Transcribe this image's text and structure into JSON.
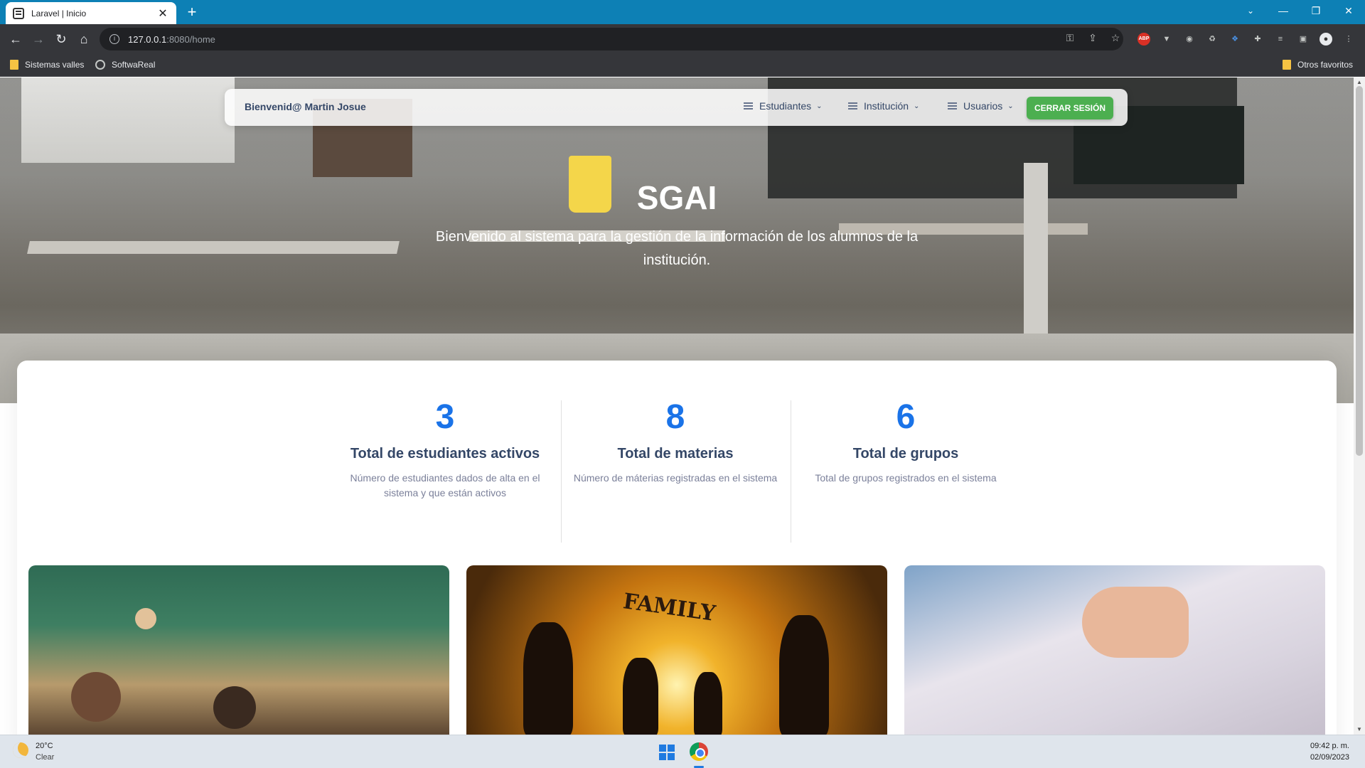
{
  "browser": {
    "tab_title": "Laravel | Inicio",
    "url_host": "127.0.0.1",
    "url_path": ":8080/home",
    "bookmarks": [
      "Sistemas valles",
      "SoftwaReal"
    ],
    "other_favorites": "Otros favoritos",
    "accent_color": "#0d80b5"
  },
  "navbar": {
    "welcome": "Bienvenid@ Martin Josue",
    "items": [
      {
        "label": "Estudiantes"
      },
      {
        "label": "Institución"
      },
      {
        "label": "Usuarios"
      }
    ],
    "logout_label": "CERRAR SESIÓN",
    "logout_color": "#4caf50"
  },
  "hero": {
    "title": "SGAI",
    "subtitle": "Bienvenido al sistema para la gestión de la información de los alumnos de la institución."
  },
  "stats": [
    {
      "value": "3",
      "label": "Total de estudiantes activos",
      "description": "Número de estudiantes dados de alta en el sistema y que están activos"
    },
    {
      "value": "8",
      "label": "Total de materias",
      "description": "Número de máterias registradas en el sistema"
    },
    {
      "value": "6",
      "label": "Total de grupos",
      "description": "Total de grupos registrados en el sistema"
    }
  ],
  "photos": {
    "family_text": "FAMILY"
  },
  "taskbar": {
    "temperature": "20°C",
    "condition": "Clear",
    "time": "09:42 p. m.",
    "date": "02/09/2023"
  },
  "colors": {
    "stat_number": "#1a73e8",
    "heading": "#344767"
  }
}
